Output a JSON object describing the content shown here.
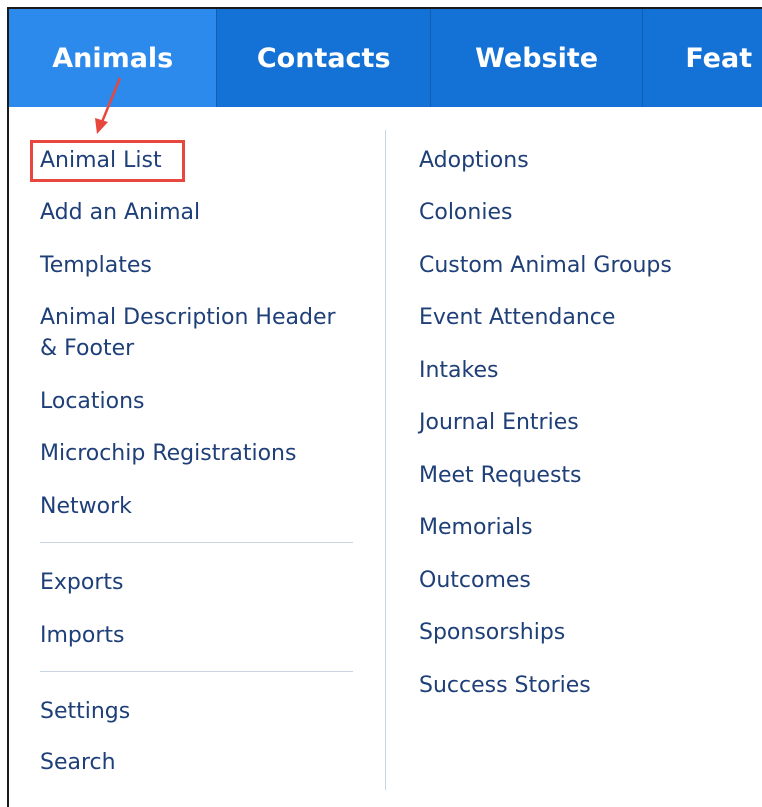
{
  "nav": {
    "tabs": [
      {
        "label": "Animals"
      },
      {
        "label": "Contacts"
      },
      {
        "label": "Website"
      },
      {
        "label": "Feat"
      }
    ]
  },
  "menu": {
    "left": {
      "group1": [
        "Animal List",
        "Add an Animal",
        "Templates",
        "Animal Description Header",
        "& Footer",
        "Locations",
        "Microchip Registrations",
        "Network"
      ],
      "group2": [
        "Exports",
        "Imports"
      ],
      "group3": [
        "Settings",
        "Search"
      ]
    },
    "right": [
      "Adoptions",
      "Colonies",
      "Custom Animal Groups",
      "Event Attendance",
      "Intakes",
      "Journal Entries",
      "Meet Requests",
      "Memorials",
      "Outcomes",
      "Sponsorships",
      "Success Stories"
    ]
  },
  "colors": {
    "nav_bg": "#1471d6",
    "nav_active": "#2b8aeb",
    "link": "#1e3f78",
    "annotation": "#e8473e"
  }
}
